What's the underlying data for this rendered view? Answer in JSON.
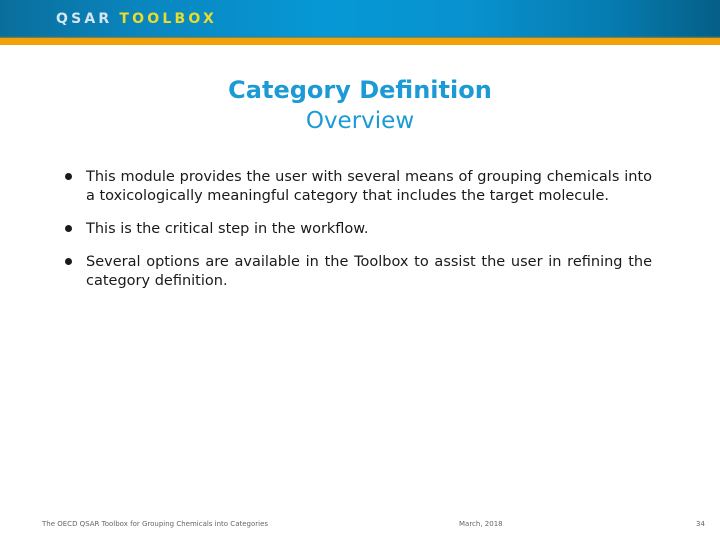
{
  "header": {
    "logo_part1": "QSAR",
    "logo_part2": "TOOLBOX",
    "colors": {
      "gradient_dark": "#0a6e9c",
      "gradient_bright": "#0698d6",
      "stripe": "#f1a20b",
      "logo_part1": "#d4e6f0",
      "logo_part2": "#e9dc2a"
    }
  },
  "slide": {
    "title": "Category Definition",
    "subtitle": "Overview",
    "title_color": "#1b9ad6",
    "bullets": [
      "This module provides the user with several means of grouping chemicals into a toxicologically meaningful category that includes the target molecule.",
      "This is the critical step in the workflow.",
      "Several options are available in the Toolbox to assist the user in refining the category definition."
    ]
  },
  "footer": {
    "left": "The OECD QSAR Toolbox for Grouping Chemicals into Categories",
    "center": "March, 2018",
    "page_number": "34"
  }
}
